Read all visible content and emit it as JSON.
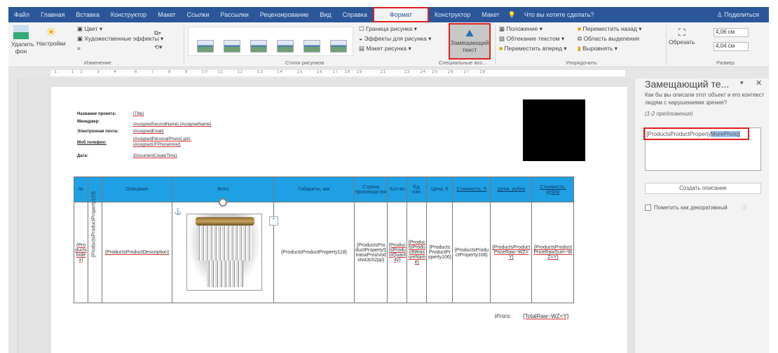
{
  "tabs": [
    "Файл",
    "Главная",
    "Вставка",
    "Конструктор",
    "Макет",
    "Ссылки",
    "Рассылки",
    "Рецензирование",
    "Вид",
    "Справка",
    "Формат",
    "Конструктор",
    "Макет"
  ],
  "tellme": "Что вы хотите сделать?",
  "share": "Поделиться",
  "ribbon": {
    "remove_bg": "Удалить фон",
    "corrections": "Настройки",
    "color": "Цвет",
    "artistic": "Художественные эффекты",
    "group_adjust": "Изменение",
    "group_styles": "Стили рисунков",
    "border": "Граница рисунка",
    "effects": "Эффекты для рисунка",
    "layout": "Макет рисунка",
    "alt_text": "Замещающий текст",
    "group_access": "Специальные воз...",
    "position": "Положение",
    "wrap": "Обтекание текстом",
    "forward": "Переместить вперед",
    "backward": "Переместить назад",
    "selection": "Область выделения",
    "align": "Выровнять",
    "group_arrange": "Упорядочить",
    "crop": "Обрезать",
    "height": "4,06 см",
    "width": "4,04 см",
    "group_size": "Размер"
  },
  "ruler": "· 1 · · · 1 · 2 · · · 3 · · · 4 · · · · 6 · · · 7 · · · 8 · · · 9 · · · 10 · · 11 · · · 12 · · · 13 · · · 14 · · · 15 · · · 16 · · 17 · 18 · 19 · · · · 21 · · · · 23 · · 24 · 25 · · 26 · · 27 · · 28",
  "header_fields": [
    {
      "label": "Название проекта:",
      "value": "{Title}"
    },
    {
      "label": "Менеджер:",
      "value": "{AssignedSecondName} {AssignedName}"
    },
    {
      "label": "Электронная почта:",
      "value": "{AssignedEmail}"
    },
    {
      "label": "Моб.телефон:",
      "value": "{AssignedPersonalPhone} доп. {AssignedUFPhoneInner}"
    },
    {
      "label": "Дата:",
      "value": "{DocumentCreateTime}"
    }
  ],
  "table": {
    "headers": [
      "№",
      "",
      "Описание",
      "Фото",
      "Габариты, мм",
      "Страна производства",
      "Кол-во",
      "Ед. изм.",
      "Цена, €",
      "Стоимость, €",
      "Цена, рубли",
      "Стоимость, рубли"
    ],
    "row": [
      "{ProductsIndex}",
      "{ProductsProductProperty120}",
      "{ProductsProductDescription}",
      "",
      "{ProductsProductProperty118}",
      "{ProductsProductPropertyStranaProizvodstva3ch2pp}",
      "{ProductsProductQuantity}",
      "{ProductsProductMeasureName}",
      "{ProductsProductProperty106}",
      "{ProductsProductProperty108}",
      "{ProductsProductPriceRaw~WZ=Y}",
      "{ProductsProductPriceRawSum~WZ=Y}"
    ]
  },
  "total": {
    "label": "Итого:",
    "value": "{TotalRaw~WZ=Y}"
  },
  "pane": {
    "title": "Замещающий те...",
    "question": "Как бы вы описали этот объект и его контекст людям с нарушениями зрения?",
    "hint": "(1-2 предложения)",
    "text_plain": "{ProductsProductProperty",
    "text_selected": "MorePhoto}",
    "generate": "Создать описание",
    "decorative": "Пометить как декоративный"
  }
}
